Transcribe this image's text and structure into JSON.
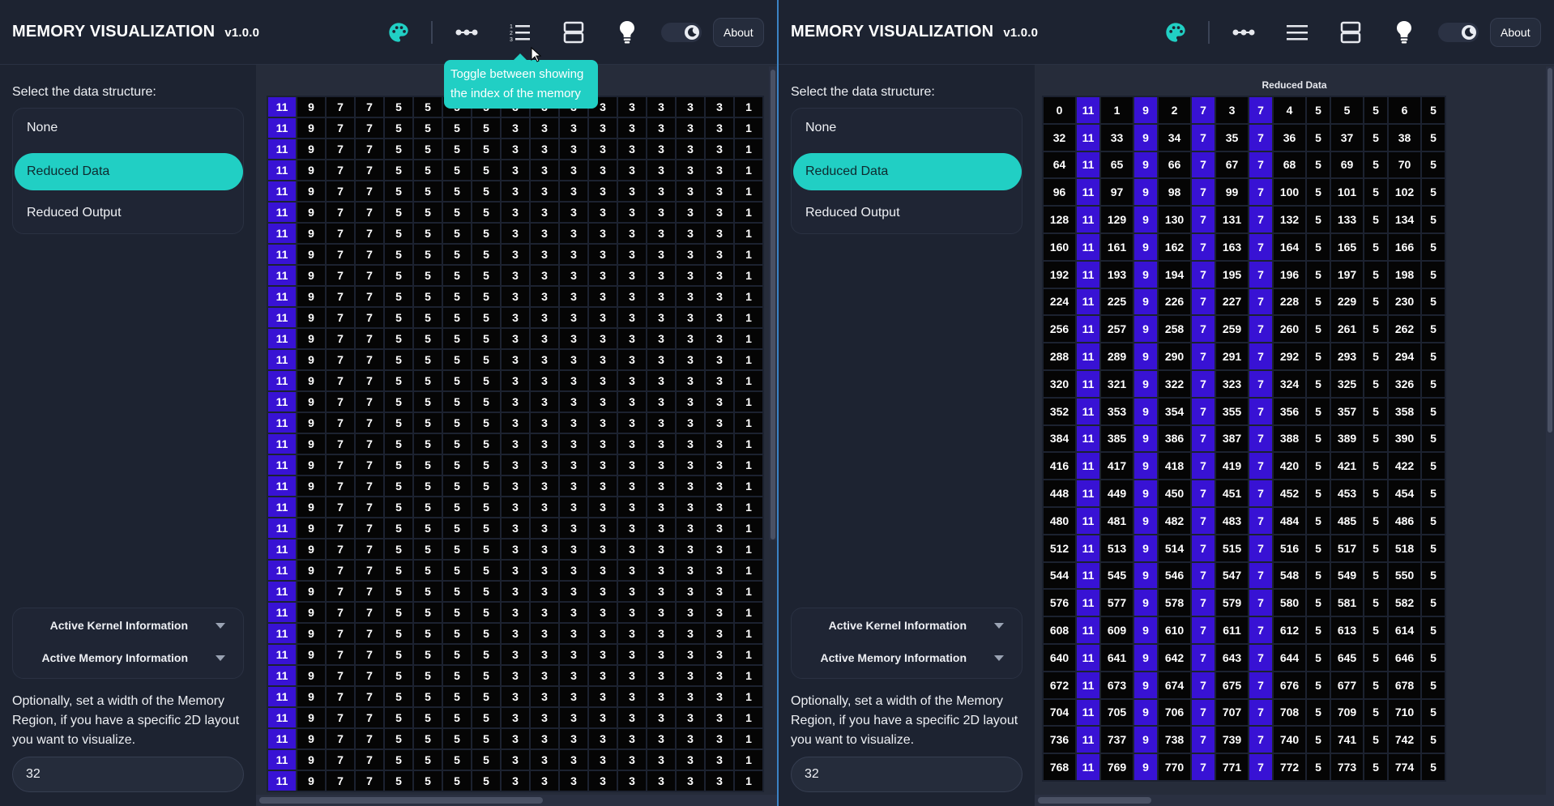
{
  "left_panel": {
    "header": {
      "title": "MEMORY VISUALIZATION",
      "version": "v1.0.0",
      "about_label": "About",
      "icons": [
        "palette-icon",
        "dots-line-icon",
        "numbered-list-icon",
        "layout-rows-icon",
        "lightbulb-icon",
        "moon-icon"
      ]
    },
    "sidebar": {
      "select_label": "Select the data structure:",
      "items": [
        {
          "label": "None"
        },
        {
          "label": "Reduced Data"
        },
        {
          "label": "Reduced Output"
        }
      ],
      "active_index": 1,
      "info": {
        "kernel_label": "Active Kernel Information",
        "memory_label": "Active Memory Information"
      },
      "width_text": "Optionally, set a width of the Memory Region, if you have a specific 2D layout you want to visualize.",
      "width_value": "32"
    },
    "grid": {
      "title": "",
      "row_values": [
        "11",
        "9",
        "7",
        "7",
        "5",
        "5",
        "5",
        "5",
        "3",
        "3",
        "3",
        "3",
        "3",
        "3",
        "3",
        "3",
        "1"
      ],
      "row_count": 33,
      "highlighted_columns": [
        0
      ]
    },
    "tooltip": {
      "text": "Toggle between showing the index of the memory"
    }
  },
  "right_panel": {
    "header": {
      "title": "MEMORY VISUALIZATION",
      "version": "v1.0.0",
      "about_label": "About",
      "icons": [
        "palette-icon",
        "dots-line-icon",
        "menu-icon",
        "layout-rows-icon",
        "lightbulb-icon",
        "moon-icon"
      ]
    },
    "sidebar": {
      "select_label": "Select the data structure:",
      "items": [
        {
          "label": "None"
        },
        {
          "label": "Reduced Data"
        },
        {
          "label": "Reduced Output"
        }
      ],
      "active_index": 1,
      "info": {
        "kernel_label": "Active Kernel Information",
        "memory_label": "Active Memory Information"
      },
      "width_text": "Optionally, set a width of the Memory Region, if you have a specific 2D layout you want to visualize.",
      "width_value": "32"
    },
    "grid": {
      "title": "Reduced Data",
      "value_pattern": [
        "11",
        "9",
        "7",
        "7",
        "5",
        "5",
        "5"
      ],
      "index_pattern": [
        0,
        1,
        2,
        3,
        4,
        5,
        6
      ],
      "row_start_indices": [
        0,
        32,
        64,
        96,
        128,
        160,
        192,
        224,
        256,
        288,
        320,
        352,
        384,
        416,
        448,
        480,
        512,
        544,
        576,
        608,
        640,
        672,
        704,
        736,
        768
      ],
      "row_step": 32,
      "highlighted_columns": [
        1,
        3,
        5,
        7
      ]
    }
  },
  "colors": {
    "accent": "#21cfc4",
    "cell_highlight": "#3812d4",
    "cell_default": "#050505",
    "background": "#1d2331"
  }
}
